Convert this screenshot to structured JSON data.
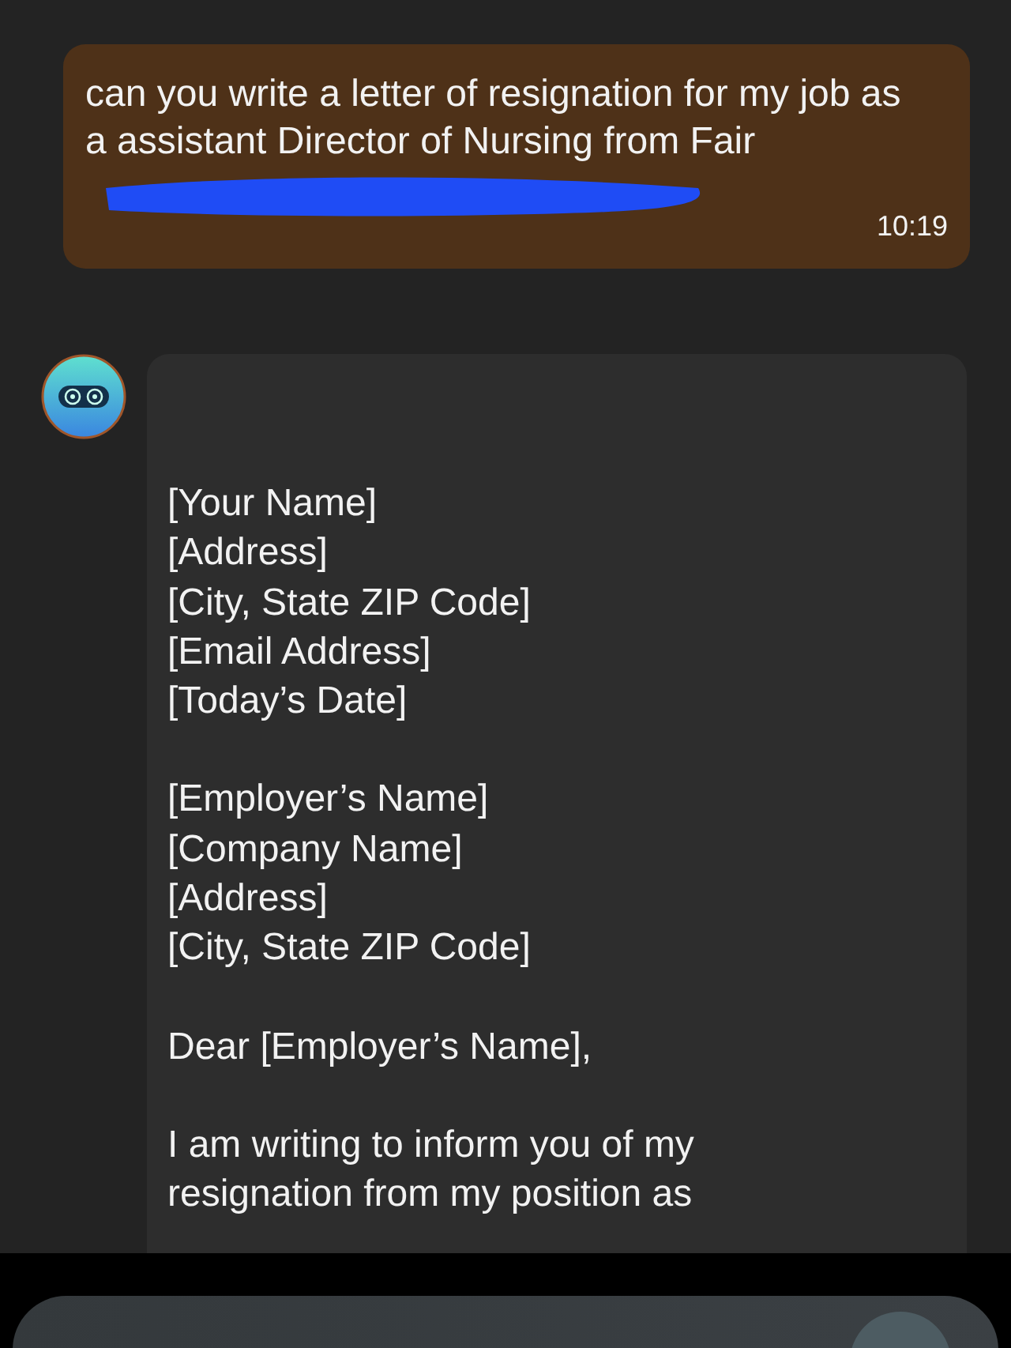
{
  "messages": [
    {
      "kind": "user",
      "text": "can you write a letter of resignation for my job as a assistant Director of Nursing from Fair",
      "redacted": true,
      "time": "10:19"
    },
    {
      "kind": "bot",
      "blocks": [
        [
          "[Your Name]",
          "[Address]",
          "[City, State ZIP Code]",
          "[Email Address]",
          "[Today’s Date]"
        ],
        [
          "[Employer’s Name]",
          "[Company Name]",
          "[Address]",
          "[City, State ZIP Code]"
        ],
        [
          "Dear [Employer’s Name],"
        ],
        [
          "I am writing to inform you of my resignation from my position as"
        ]
      ]
    }
  ]
}
